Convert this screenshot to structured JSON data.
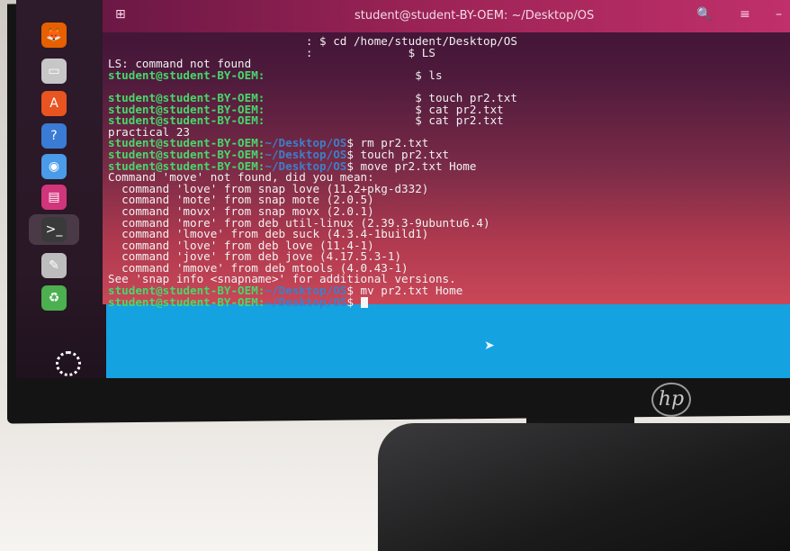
{
  "window": {
    "title": "student@student-BY-OEM: ~/Desktop/OS",
    "buttons": {
      "new_tab": "⊞",
      "search": "🔍",
      "menu": "≡",
      "minimize": "–"
    }
  },
  "terminal": {
    "lines": [
      {
        "prompt": "",
        "path": "",
        "text": "                             : $ cd /home/student/Desktop/OS"
      },
      {
        "prompt": "",
        "path": "",
        "text": "                             :              $ LS"
      },
      {
        "prompt": "",
        "path": "",
        "text": "LS: command not found"
      },
      {
        "prompt": "student@student-BY-OEM:",
        "path": "",
        "text": "                      $ ls"
      },
      {
        "prompt": "",
        "path": "",
        "text": ""
      },
      {
        "prompt": "student@student-BY-OEM:",
        "path": "",
        "text": "                      $ touch pr2.txt"
      },
      {
        "prompt": "student@student-BY-OEM:",
        "path": "",
        "text": "                      $ cat pr2.txt"
      },
      {
        "prompt": "student@student-BY-OEM:",
        "path": "",
        "text": "                      $ cat pr2.txt"
      },
      {
        "prompt": "",
        "path": "",
        "text": "practical 23"
      },
      {
        "prompt": "student@student-BY-OEM:",
        "path": "~/Desktop/OS",
        "text": "$ rm pr2.txt"
      },
      {
        "prompt": "student@student-BY-OEM:",
        "path": "~/Desktop/OS",
        "text": "$ touch pr2.txt"
      },
      {
        "prompt": "student@student-BY-OEM:",
        "path": "~/Desktop/OS",
        "text": "$ move pr2.txt Home"
      },
      {
        "prompt": "",
        "path": "",
        "text": "Command 'move' not found, did you mean:"
      },
      {
        "prompt": "",
        "path": "",
        "text": "  command 'love' from snap love (11.2+pkg-d332)"
      },
      {
        "prompt": "",
        "path": "",
        "text": "  command 'mote' from snap mote (2.0.5)"
      },
      {
        "prompt": "",
        "path": "",
        "text": "  command 'movx' from snap movx (2.0.1)"
      },
      {
        "prompt": "",
        "path": "",
        "text": "  command 'more' from deb util-linux (2.39.3-9ubuntu6.4)"
      },
      {
        "prompt": "",
        "path": "",
        "text": "  command 'lmove' from deb suck (4.3.4-1build1)"
      },
      {
        "prompt": "",
        "path": "",
        "text": "  command 'love' from deb love (11.4-1)"
      },
      {
        "prompt": "",
        "path": "",
        "text": "  command 'jove' from deb jove (4.17.5.3-1)"
      },
      {
        "prompt": "",
        "path": "",
        "text": "  command 'mmove' from deb mtools (4.0.43-1)"
      },
      {
        "prompt": "",
        "path": "",
        "text": "See 'snap info <snapname>' for additional versions."
      },
      {
        "prompt": "student@student-BY-OEM:",
        "path": "~/Desktop/OS",
        "text": "$ mv pr2.txt Home"
      },
      {
        "prompt": "student@student-BY-OEM:",
        "path": "~/Desktop/OS",
        "text": "$ ",
        "cursor": true
      }
    ]
  },
  "dock": {
    "items": [
      {
        "name": "firefox-icon",
        "glyph": "🦊",
        "color": "#e66000"
      },
      {
        "name": "files-icon",
        "glyph": "▭",
        "color": "#c7c7c7"
      },
      {
        "name": "app-center-icon",
        "glyph": "A",
        "color": "#e95420"
      },
      {
        "name": "help-icon",
        "glyph": "?",
        "color": "#3a7bd5"
      },
      {
        "name": "chromium-icon",
        "glyph": "◉",
        "color": "#4a9be8"
      },
      {
        "name": "impress-icon",
        "glyph": "▤",
        "color": "#d1357b"
      },
      {
        "name": "terminal-icon",
        "glyph": ">_",
        "color": "#3a3a3a"
      },
      {
        "name": "text-editor-icon",
        "glyph": "✎",
        "color": "#bdbdbd"
      },
      {
        "name": "trash-icon",
        "glyph": "♻",
        "color": "#4caf50"
      }
    ],
    "show_apps_icon": "ubuntu-logo-icon"
  },
  "desktop": {
    "accent": "#14a2e1"
  },
  "monitor": {
    "brand": "hp"
  }
}
